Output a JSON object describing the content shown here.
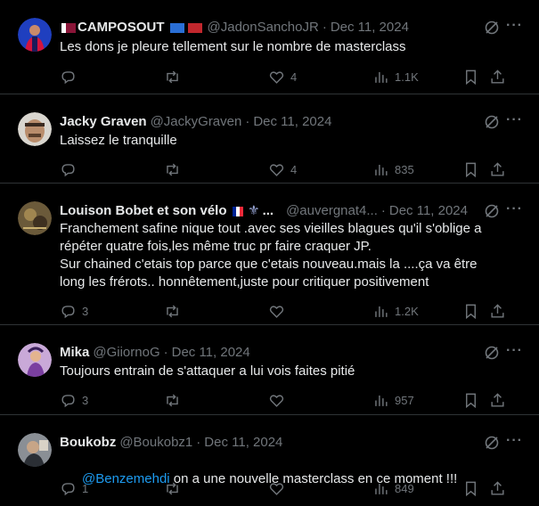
{
  "tweets": [
    {
      "name": "CAMPOSOUT",
      "handle": "@JadonSanchoJR",
      "date": "Dec 11, 2024",
      "text": "Les dons je pleure tellement sur le nombre de masterclass",
      "replies": "",
      "reposts": "",
      "likes": "4",
      "views": "1.1K"
    },
    {
      "name": "Jacky Graven",
      "handle": "@JackyGraven",
      "date": "Dec 11, 2024",
      "text": "Laissez le tranquille",
      "replies": "",
      "reposts": "",
      "likes": "4",
      "views": "835"
    },
    {
      "name": "Louison Bobet et son vélo",
      "name_suffix": "...",
      "handle": "@auvergnat4...",
      "date": "Dec 11, 2024",
      "text": "Franchement safine nique tout .avec ses vieilles blagues qu'il s'oblige a répéter quatre fois,les même truc pr faire craquer JP.\nSur chained c'etais top parce que c'etais nouveau.mais la ....ça va être long les frérots.. honnêtement,juste pour critiquer positivement",
      "replies": "3",
      "reposts": "",
      "likes": "",
      "views": "1.2K"
    },
    {
      "name": "Mika",
      "handle": "@GiiornoG",
      "date": "Dec 11, 2024",
      "text": "Toujours entrain de s'attaquer a lui vois faites pitié",
      "replies": "3",
      "reposts": "",
      "likes": "",
      "views": "957"
    },
    {
      "name": "Boukobz",
      "handle": "@Boukobz1",
      "date": "Dec 11, 2024",
      "mention": "@Benzemehdi",
      "text": " on a une nouvelle masterclass en ce moment !!!",
      "replies": "1",
      "reposts": "",
      "likes": "",
      "views": "849"
    }
  ],
  "separator": "·",
  "more_glyph": "···"
}
